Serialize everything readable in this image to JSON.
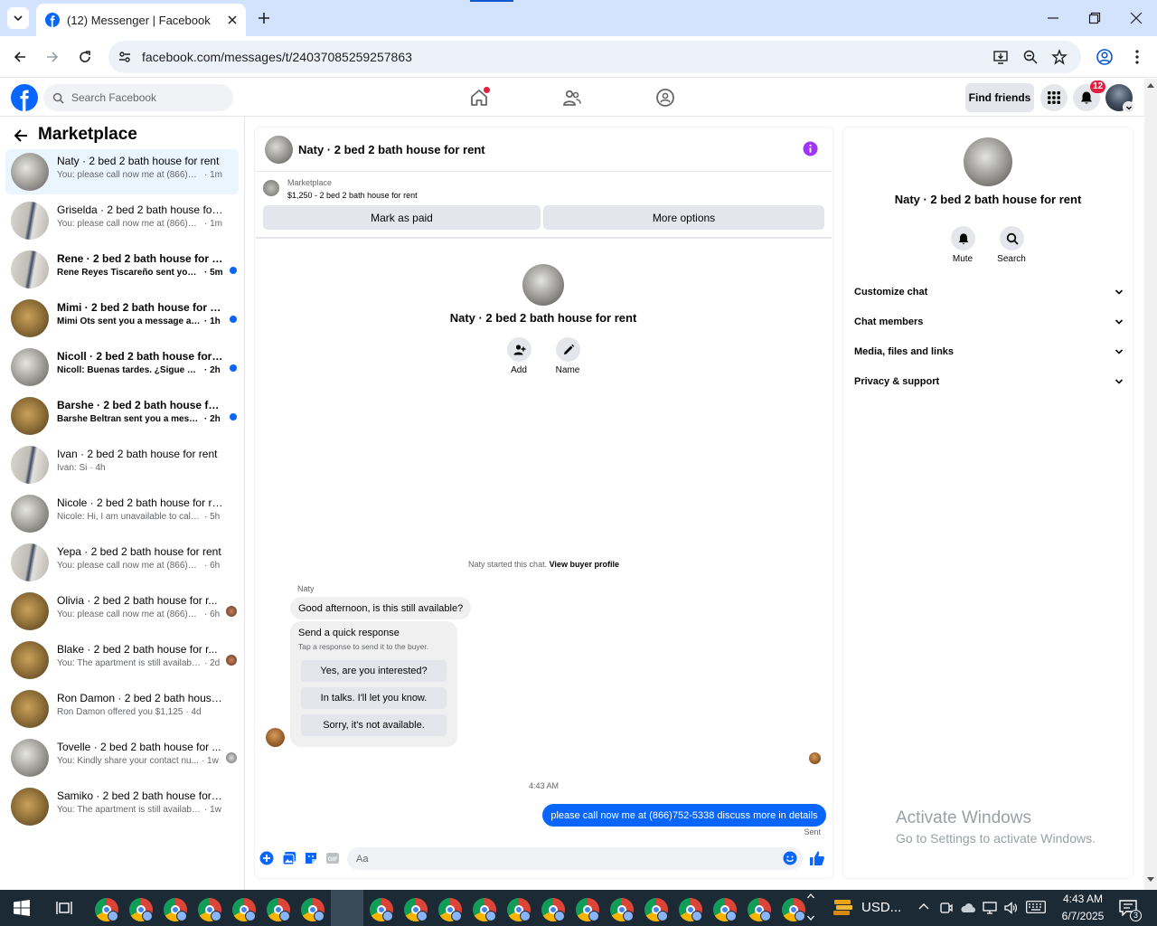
{
  "browser": {
    "tab_title": "(12) Messenger | Facebook",
    "url": "facebook.com/messages/t/24037085259257863"
  },
  "fb_header": {
    "search_placeholder": "Search Facebook",
    "find_friends": "Find friends",
    "notification_count": "12"
  },
  "sidebar": {
    "title": "Marketplace",
    "conversations": [
      {
        "name": "Naty · 2 bed 2 bath house for rent",
        "snippet": "You: please call now me at (866)752-...",
        "time": "· 1m",
        "unread": false,
        "active": true
      },
      {
        "name": "Griselda · 2 bed 2 bath house for r...",
        "snippet": "You: please call now me at (866)752-...",
        "time": "· 1m",
        "unread": false
      },
      {
        "name": "Rene · 2 bed 2 bath house for rent",
        "snippet": "Rene Reyes Tiscareño sent you a ...",
        "time": "· 5m",
        "unread": true
      },
      {
        "name": "Mimi · 2 bed 2 bath house for rent",
        "snippet": "Mimi Ots sent you a message abo...",
        "time": "· 1h",
        "unread": true
      },
      {
        "name": "Nicoll · 2 bed 2 bath house for re...",
        "snippet": "Nicoll: Buenas tardes. ¿Sigue dispo...",
        "time": "· 2h",
        "unread": true
      },
      {
        "name": "Barshe · 2 bed 2 bath house for r...",
        "snippet": "Barshe Beltran sent you a message...",
        "time": "· 2h",
        "unread": true
      },
      {
        "name": "Ivan · 2 bed 2 bath house for rent",
        "snippet": "Ivan: Si",
        "time": "· 4h",
        "unread": false
      },
      {
        "name": "Nicole · 2 bed 2 bath house for rent",
        "snippet": "Nicole: Hi, I am unavailable to call tod...",
        "time": "· 5h",
        "unread": false
      },
      {
        "name": "Yepa · 2 bed 2 bath house for rent",
        "snippet": "You: please call now me at (866)752-5...",
        "time": "· 6h",
        "unread": false
      },
      {
        "name": "Olivia · 2 bed 2 bath house for r...",
        "snippet": "You: please call now me at (866)75...",
        "time": "· 6h",
        "unread": false
      },
      {
        "name": "Blake · 2 bed 2 bath house for r...",
        "snippet": "You: The apartment is still available...",
        "time": "· 2d",
        "unread": false
      },
      {
        "name": "Ron Damon · 2 bed 2 bath house f...",
        "snippet": "Ron Damon offered you $1,125",
        "time": "· 4d",
        "unread": false
      },
      {
        "name": "Tovelle · 2 bed 2 bath house for ...",
        "snippet": "You: Kindly share your contact nu...",
        "time": "· 1w",
        "unread": false
      },
      {
        "name": "Samiko · 2 bed 2 bath house for re...",
        "snippet": "You: The apartment is still available fo...",
        "time": "· 1w",
        "unread": false
      }
    ]
  },
  "chat": {
    "header_title": "Naty · 2 bed 2 bath house for rent",
    "listing_source": "Marketplace",
    "listing_info": "$1,250 - 2 bed 2 bath house for rent",
    "mark_paid": "Mark as paid",
    "more_options": "More options",
    "profile_name": "Naty · 2 bed 2 bath house for rent",
    "add_label": "Add",
    "name_label": "Name",
    "started_text": "Naty started this chat.",
    "view_profile": "View buyer profile",
    "sender_name": "Naty",
    "incoming_message": "Good afternoon, is this still available?",
    "quick_title": "Send a quick response",
    "quick_sub": "Tap a response to send it to the buyer.",
    "quick_responses": [
      "Yes, are you interested?",
      "In talks. I'll let you know.",
      "Sorry, it's not available."
    ],
    "timestamp": "4:43 AM",
    "outgoing_message": "please call now me at (866)752-5338 discuss more in details",
    "sent_status": "Sent",
    "composer_placeholder": "Aa"
  },
  "info_panel": {
    "name": "Naty · 2 bed 2 bath house for rent",
    "mute": "Mute",
    "search": "Search",
    "sections": [
      "Customize chat",
      "Chat members",
      "Media, files and links",
      "Privacy & support"
    ]
  },
  "watermark": {
    "line1": "Activate Windows",
    "line2": "Go to Settings to activate Windows."
  },
  "taskbar": {
    "currency": "USD...",
    "time": "4:43 AM",
    "date": "6/7/2025",
    "notif_count": "3"
  },
  "colors": {
    "accent": "#0866ff",
    "messenger_purple": "#a033ff",
    "taskbar": "#1c2a36"
  }
}
